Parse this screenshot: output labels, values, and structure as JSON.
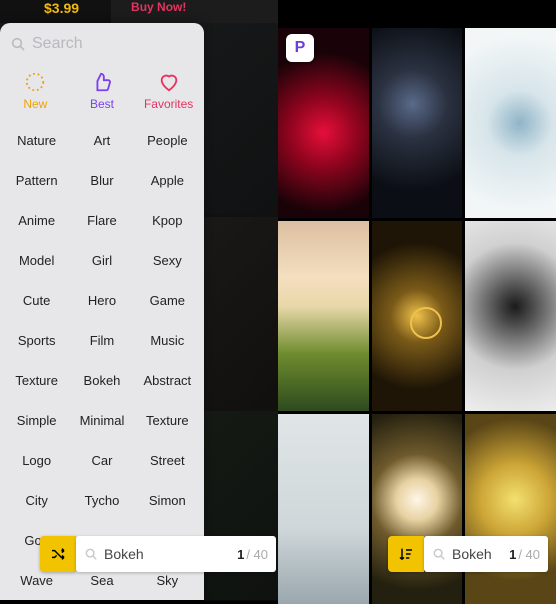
{
  "banner": {
    "price": "$3.99",
    "cta": "Buy Now!"
  },
  "search": {
    "placeholder": "Search"
  },
  "tabs": {
    "new": "New",
    "best": "Best",
    "favorites": "Favorites"
  },
  "categories": [
    "Nature",
    "Art",
    "People",
    "Pattern",
    "Blur",
    "Apple",
    "Anime",
    "Flare",
    "Kpop",
    "Model",
    "Girl",
    "Sexy",
    "Cute",
    "Hero",
    "Game",
    "Sports",
    "Film",
    "Music",
    "Texture",
    "Bokeh",
    "Abstract",
    "Simple",
    "Minimal",
    "Texture",
    "Logo",
    "Car",
    "Street",
    "City",
    "Tycho",
    "Simon",
    "Goo",
    "",
    "",
    "Wave",
    "Sea",
    "Sky"
  ],
  "bottom_search": {
    "term": "Bokeh",
    "current": "1",
    "total": "/ 40"
  },
  "badge": {
    "letter": "P"
  },
  "tiles": [
    {
      "name": "tile-red-bokeh"
    },
    {
      "name": "tile-berries"
    },
    {
      "name": "tile-waterdrop"
    },
    {
      "name": "tile-sunset-grass"
    },
    {
      "name": "tile-clock"
    },
    {
      "name": "tile-camera-man"
    },
    {
      "name": "tile-frost-plants"
    },
    {
      "name": "tile-spiral"
    },
    {
      "name": "tile-bananas"
    }
  ]
}
